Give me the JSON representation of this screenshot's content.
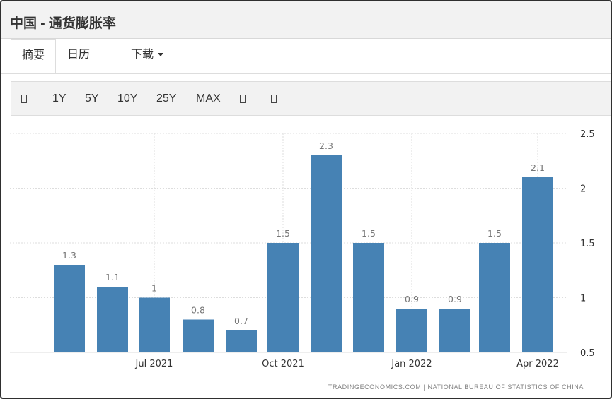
{
  "header": {
    "title": "中国 - 通货膨胀率"
  },
  "tabs": [
    {
      "label": "摘要"
    },
    {
      "label": "日历"
    },
    {
      "label": "下载"
    }
  ],
  "toolbar": {
    "buttons": [
      "1Y",
      "5Y",
      "10Y",
      "25Y",
      "MAX"
    ]
  },
  "source_text": "TRADINGECONOMICS.COM | NATIONAL BUREAU OF STATISTICS OF CHINA",
  "colors": {
    "bar": "#4682b4",
    "grid": "#dddddd"
  },
  "chart_data": {
    "type": "bar",
    "categories": [
      "",
      "",
      "Jul 2021",
      "",
      "",
      "Oct 2021",
      "",
      "",
      "Jan 2022",
      "",
      "",
      "Apr 2022"
    ],
    "values": [
      1.3,
      1.1,
      1,
      0.8,
      0.7,
      1.5,
      2.3,
      1.5,
      0.9,
      0.9,
      1.5,
      2.1
    ],
    "data_labels": [
      "1.3",
      "1.1",
      "1",
      "0.8",
      "0.7",
      "1.5",
      "2.3",
      "1.5",
      "0.9",
      "0.9",
      "1.5",
      "2.1"
    ],
    "y_ticks": [
      0.5,
      1,
      1.5,
      2,
      2.5
    ],
    "y_tick_labels": [
      "0.5",
      "1",
      "1.5",
      "2",
      "2.5"
    ],
    "x_tick_labels": [
      "Jul 2021",
      "Oct 2021",
      "Jan 2022",
      "Apr 2022"
    ],
    "ylim": [
      0.5,
      2.5
    ],
    "grid": true,
    "y_axis_side": "right"
  }
}
